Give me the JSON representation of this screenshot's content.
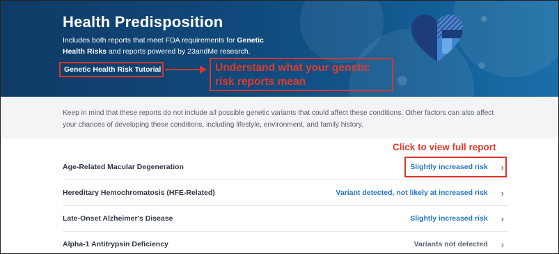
{
  "header": {
    "title": "Health Predisposition",
    "desc_part1": "Includes both reports that meet FDA requirements for ",
    "desc_bold": "Genetic Health Risks",
    "desc_part2": " and reports powered by 23andMe research.",
    "tutorial_link": "Genetic Health Risk Tutorial",
    "callout_line1": "Understand what your genetic",
    "callout_line2": "risk reports mean"
  },
  "note": "Keep in mind that these reports do not include all possible genetic variants that could affect these conditions. Other factors can also affect your chances of developing these conditions, including lifestyle, environment, and family history.",
  "annotation": "Click to view full report",
  "reports": [
    {
      "name": "Age-Related Macular Degeneration",
      "status": "Slightly increased risk",
      "status_type": "blue"
    },
    {
      "name": "Hereditary Hemochromatosis (HFE-Related)",
      "status": "Variant detected, not likely at increased risk",
      "status_type": "blue"
    },
    {
      "name": "Late-Onset Alzheimer's Disease",
      "status": "Slightly increased risk",
      "status_type": "blue"
    },
    {
      "name": "Alpha-1 Antitrypsin Deficiency",
      "status": "Variants not detected",
      "status_type": "gray"
    }
  ],
  "chevron": "›",
  "colors": {
    "header_bg": "#104a7c",
    "status_blue": "#2174c7",
    "status_gray": "#5c6670",
    "annotation_red": "#e23a2d"
  },
  "icons": {
    "heart": "heart-icon",
    "chevron": "chevron-right-icon"
  }
}
